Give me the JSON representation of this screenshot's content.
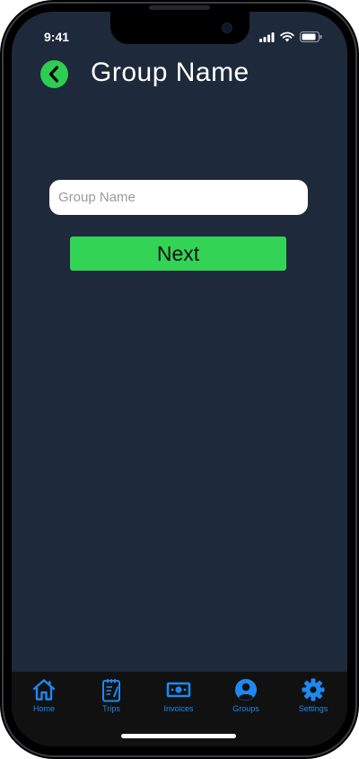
{
  "status_bar": {
    "time": "9:41"
  },
  "header": {
    "title": "Group Name",
    "back_icon": "chevron-left-icon"
  },
  "form": {
    "group_name_placeholder": "Group Name",
    "group_name_value": "",
    "next_label": "Next"
  },
  "tab_bar": {
    "items": [
      {
        "label": "Home",
        "icon": "home-icon"
      },
      {
        "label": "Trips",
        "icon": "clipboard-icon"
      },
      {
        "label": "Invoices",
        "icon": "cash-icon"
      },
      {
        "label": "Groups",
        "icon": "user-circle-icon"
      },
      {
        "label": "Settings",
        "icon": "gear-icon"
      }
    ]
  },
  "colors": {
    "background": "#1e293b",
    "accent_green": "#33d455",
    "tab_blue": "#1e88f0",
    "tab_bar_background": "#111111"
  }
}
